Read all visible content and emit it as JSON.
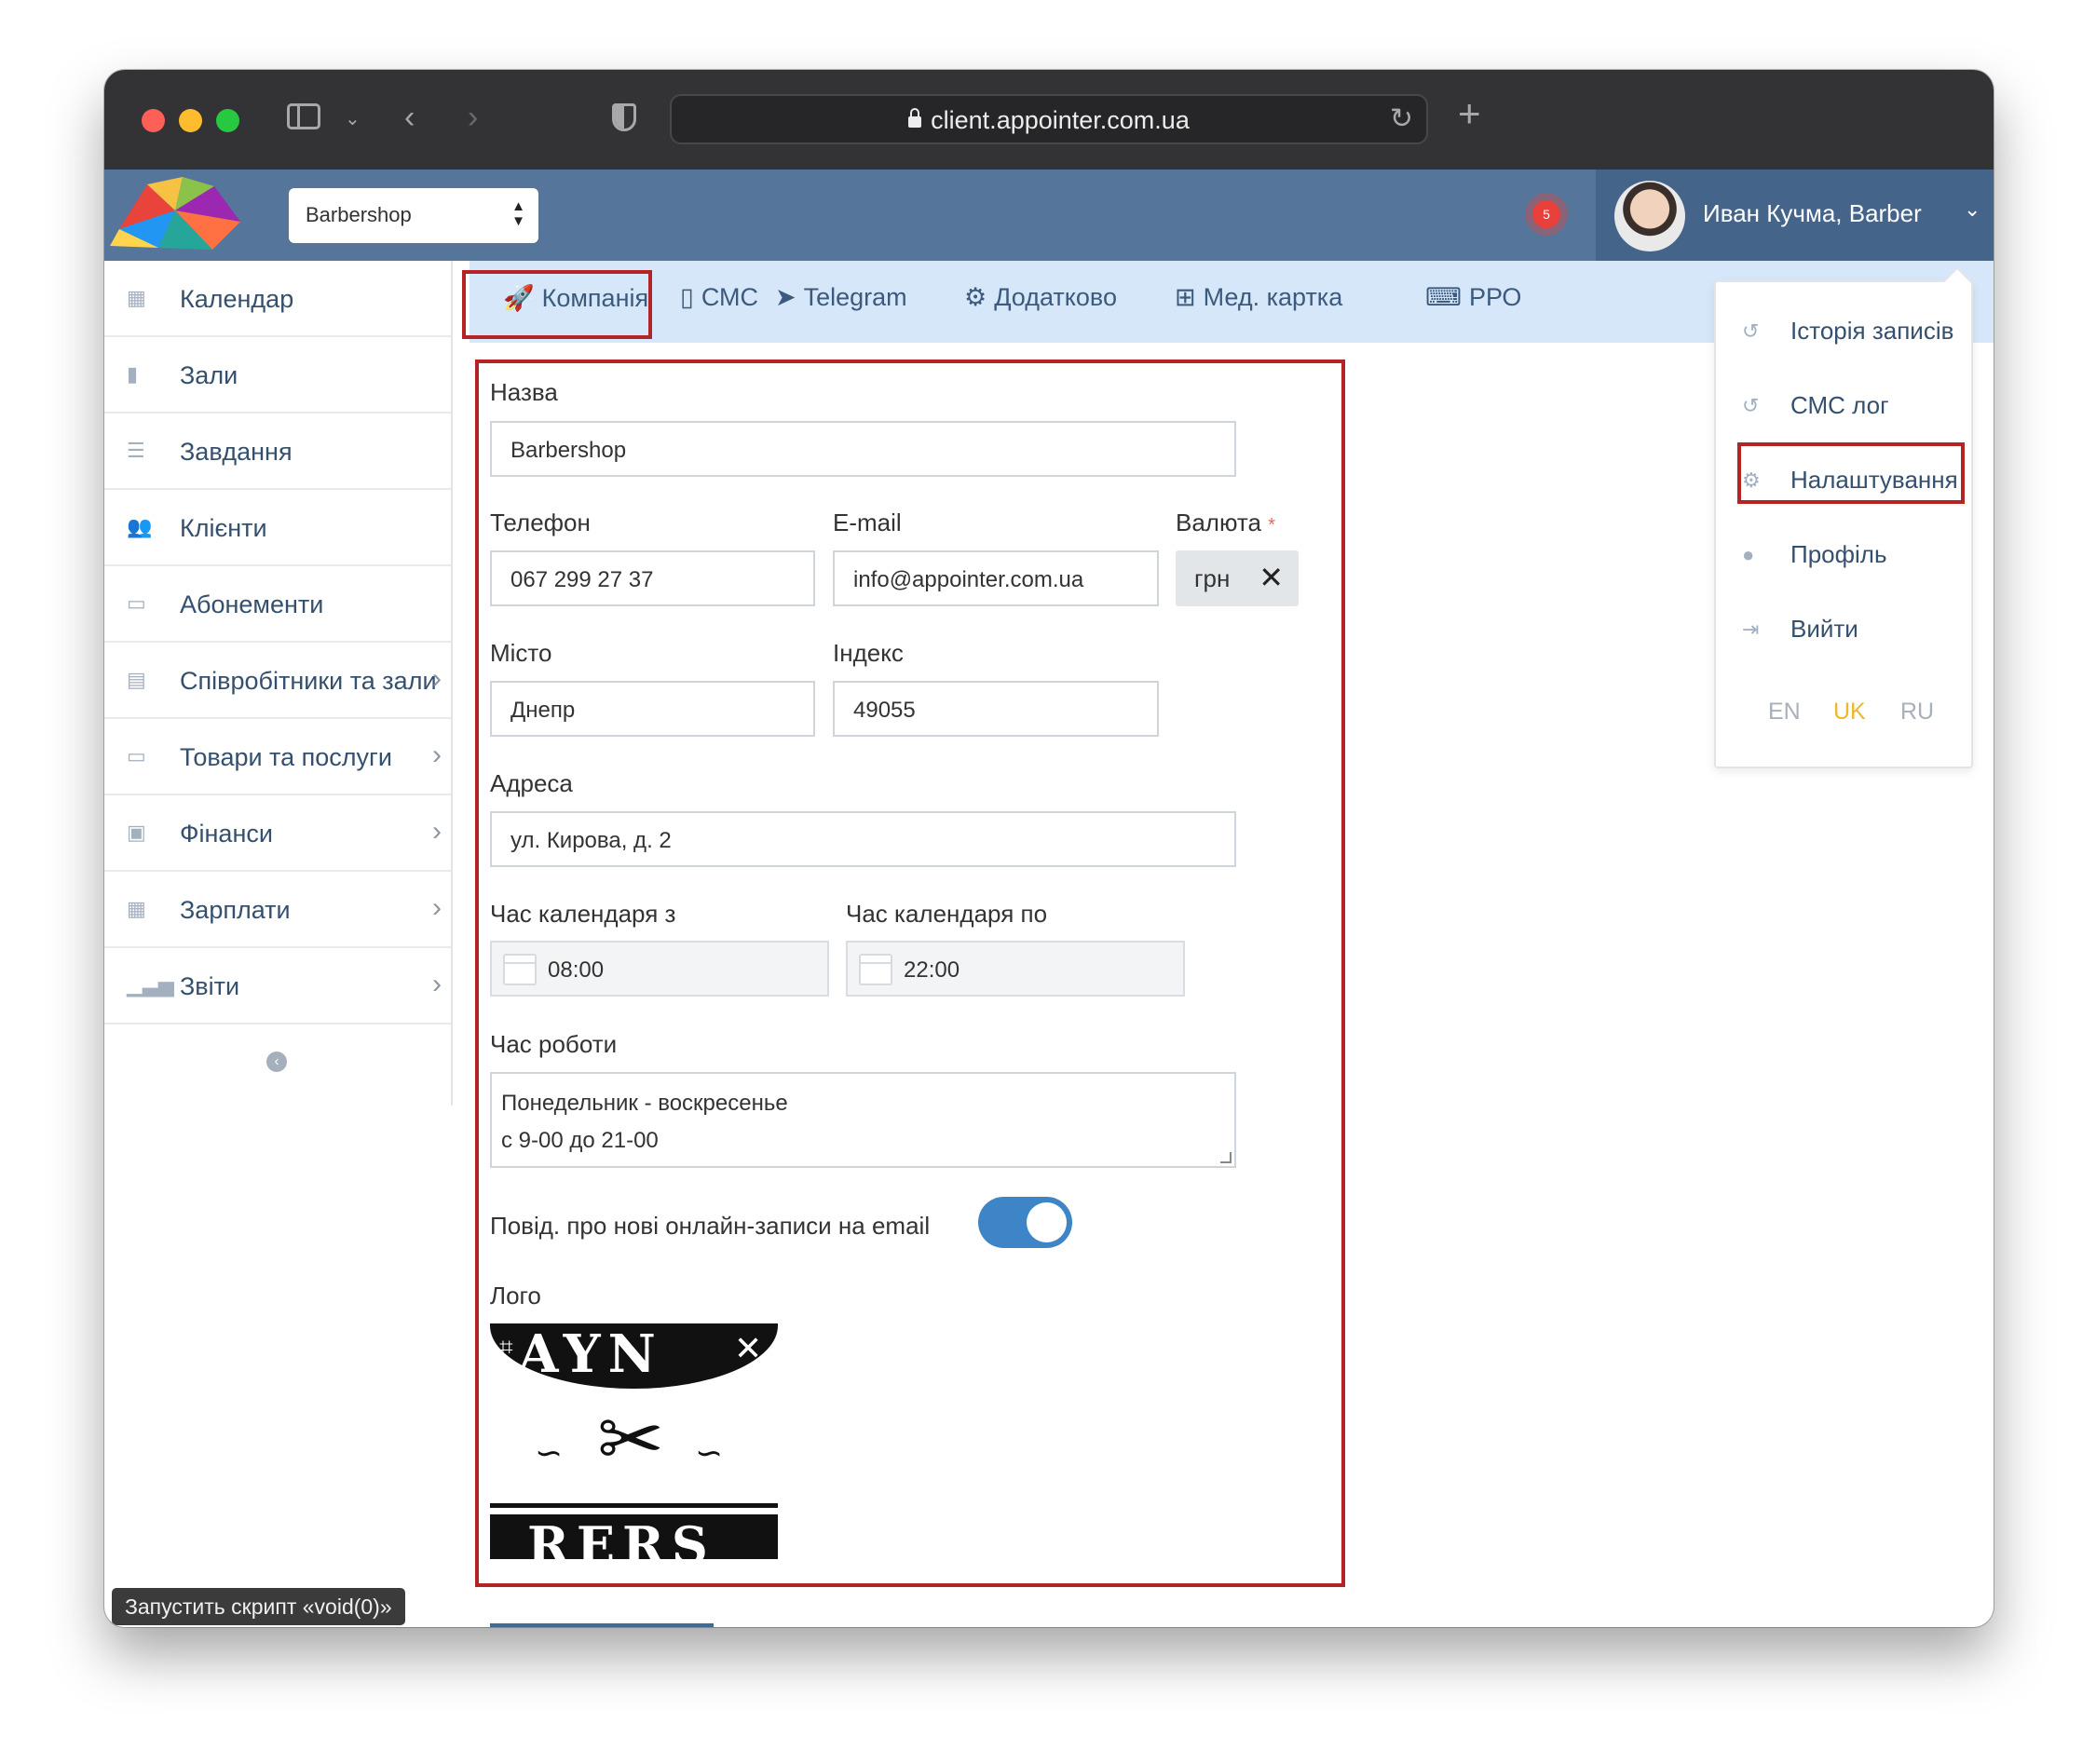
{
  "browser": {
    "url": "client.appointer.com.ua"
  },
  "header": {
    "branch_select": "Barbershop",
    "notification_count": "5",
    "user_name": "Иван Кучма, Barber"
  },
  "sidebar": {
    "items": [
      {
        "label": "Календар",
        "icon": "calendar-icon",
        "has_submenu": false
      },
      {
        "label": "Зали",
        "icon": "bookmark-icon",
        "has_submenu": false
      },
      {
        "label": "Завдання",
        "icon": "tasks-icon",
        "has_submenu": false
      },
      {
        "label": "Клієнти",
        "icon": "users-icon",
        "has_submenu": false
      },
      {
        "label": "Абонементи",
        "icon": "card-icon",
        "has_submenu": false
      },
      {
        "label": "Співробітники та зали",
        "icon": "id-card-icon",
        "has_submenu": true
      },
      {
        "label": "Товари та послуги",
        "icon": "card-icon",
        "has_submenu": true
      },
      {
        "label": "Фінанси",
        "icon": "money-icon",
        "has_submenu": true
      },
      {
        "label": "Зарплати",
        "icon": "calculator-icon",
        "has_submenu": true
      },
      {
        "label": "Звіти",
        "icon": "bar-chart-icon",
        "has_submenu": true
      }
    ]
  },
  "status_tooltip": "Запустить скрипт «void(0)»",
  "tabs": [
    {
      "label": "Компанія",
      "icon": "rocket-icon",
      "active": true
    },
    {
      "label": "СМС",
      "icon": "phone-icon",
      "active": false
    },
    {
      "label": "Telegram",
      "icon": "telegram-icon",
      "active": false
    },
    {
      "label": "Додатково",
      "icon": "gears-icon",
      "active": false
    },
    {
      "label": "Мед. картка",
      "icon": "plus-square-icon",
      "active": false
    },
    {
      "label": "РРО",
      "icon": "keyboard-icon",
      "active": false
    }
  ],
  "form": {
    "name_label": "Назва",
    "name_value": "Barbershop",
    "phone_label": "Телефон",
    "phone_value": "067 299 27 37",
    "email_label": "E-mail",
    "email_value": "info@appointer.com.ua",
    "currency_label": "Валюта",
    "currency_required_mark": "*",
    "currency_value": "грн",
    "city_label": "Місто",
    "city_value": "Днепр",
    "index_label": "Індекс",
    "index_value": "49055",
    "address_label": "Адреса",
    "address_value": "ул. Кирова, д. 2",
    "calendar_from_label": "Час календаря з",
    "calendar_from_value": "08:00",
    "calendar_to_label": "Час календаря по",
    "calendar_to_value": "22:00",
    "work_hours_label": "Час роботи",
    "work_hours_line1": "Понедельник - воскресенье",
    "work_hours_line2": "с 9-00 до 21-00",
    "email_notify_label": "Повід. про нові онлайн-записи на email",
    "email_notify_on": true,
    "logo_label": "Лого"
  },
  "user_menu": {
    "items": [
      {
        "label": "Історія записів",
        "icon": "history-icon"
      },
      {
        "label": "СМС лог",
        "icon": "history-icon"
      },
      {
        "label": "Налаштування",
        "icon": "gears-icon"
      },
      {
        "label": "Профіль",
        "icon": "user-icon"
      },
      {
        "label": "Вийти",
        "icon": "sign-out-icon"
      }
    ],
    "languages": [
      "EN",
      "UK",
      "RU"
    ],
    "active_language": "UK"
  },
  "colors": {
    "header_bg": "#55769a",
    "user_area_bg": "#45648a",
    "tabs_bg": "#d6e7f9",
    "highlight_border": "#b42325",
    "toggle_on": "#3d85c6",
    "active_language": "#f0b727"
  }
}
